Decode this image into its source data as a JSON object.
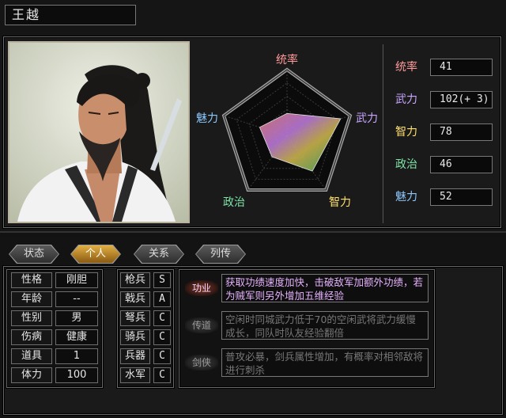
{
  "character": {
    "name": "王越"
  },
  "radar": {
    "axes": [
      "统率",
      "武力",
      "智力",
      "政治",
      "魅力"
    ],
    "axis_colors": [
      "#ff9a9a",
      "#c9a6ff",
      "#ffe06a",
      "#7de2a8",
      "#8cc8ff"
    ],
    "values": [
      41,
      102,
      78,
      46,
      52
    ],
    "max": 120
  },
  "stats": [
    {
      "label": "统率",
      "value": "41",
      "color": "#ff9a9a"
    },
    {
      "label": "武力",
      "value": "102(+ 3)",
      "color": "#c9a6ff"
    },
    {
      "label": "智力",
      "value": "78",
      "color": "#ffe06a"
    },
    {
      "label": "政治",
      "value": "46",
      "color": "#7de2a8"
    },
    {
      "label": "魅力",
      "value": "52",
      "color": "#8cc8ff"
    }
  ],
  "tabs": [
    {
      "label": "状态",
      "active": false
    },
    {
      "label": "个人",
      "active": true
    },
    {
      "label": "关系",
      "active": false
    },
    {
      "label": "列传",
      "active": false
    }
  ],
  "personal": [
    {
      "label": "性格",
      "value": "刚胆"
    },
    {
      "label": "年龄",
      "value": "--"
    },
    {
      "label": "性别",
      "value": "男"
    },
    {
      "label": "伤病",
      "value": "健康"
    },
    {
      "label": "道具",
      "value": "1"
    },
    {
      "label": "体力",
      "value": "100"
    }
  ],
  "aptitudes": [
    {
      "label": "枪兵",
      "grade": "S"
    },
    {
      "label": "戟兵",
      "grade": "A"
    },
    {
      "label": "弩兵",
      "grade": "C"
    },
    {
      "label": "骑兵",
      "grade": "C"
    },
    {
      "label": "兵器",
      "grade": "C"
    },
    {
      "label": "水军",
      "grade": "C"
    }
  ],
  "skills": [
    {
      "name": "功业",
      "active": true,
      "desc": "获取功绩速度加快，击破敌军加额外功绩，若为贼军则另外增加五维经验",
      "text_color": "#e6b3ff"
    },
    {
      "name": "传道",
      "active": false,
      "desc": "空闲时同城武力低于70的空闲武将武力缓慢成长，同队时队友经验翻倍",
      "text_color": "#777777"
    },
    {
      "name": "剑侠",
      "active": false,
      "desc": "普攻必暴，剑兵属性增加，有概率对相邻敌将进行刺杀",
      "text_color": "#777777"
    }
  ]
}
